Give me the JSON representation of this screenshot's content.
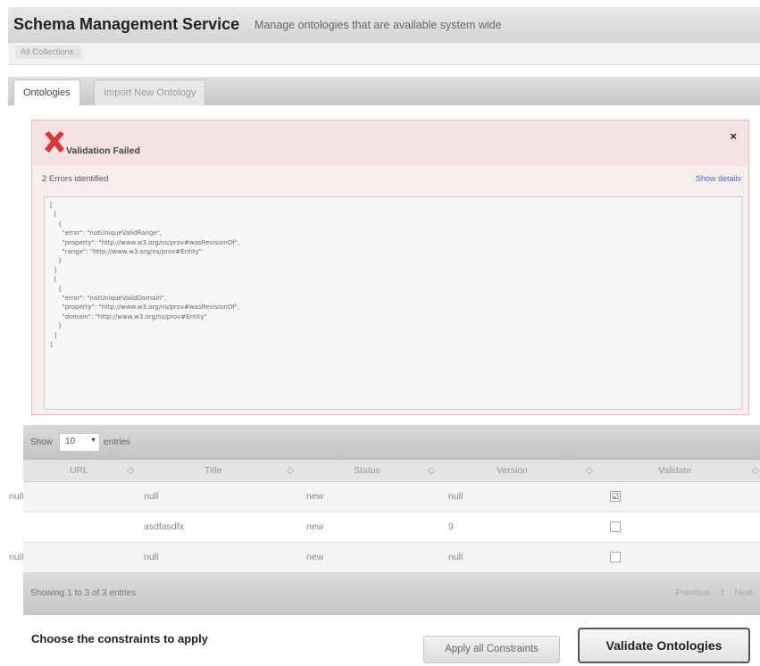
{
  "header": {
    "title": "Schema Management Service",
    "subtitle": "Manage ontologies that are available system wide"
  },
  "breadcrumb": {
    "item": "All Collections"
  },
  "tabs": [
    {
      "label": "Ontologies",
      "active": true
    },
    {
      "label": "Import New Ontology",
      "active": false
    }
  ],
  "alert": {
    "icon": "error-x-icon",
    "title": "Validation Failed",
    "close": "×",
    "error_count": "2 Errors identified",
    "show_details": "Show details",
    "details": "[\n  [\n    {\n      \"error\": \"notUniqueValidRange\",\n      \"property\": \"http://www.w3.org/ns/prov#wasRevisionOf\",\n      \"range\": \"http://www.w3.org/ns/prov#Entity\"\n    }\n  ]\n  [\n    {\n      \"error\": \"notUniqueValidDomain\",\n      \"property\": \"http://www.w3.org/ns/prov#wasRevisionOf\",\n      \"domain\": \"http://www.w3.org/ns/prov#Entity\"\n    }\n  ]\n]"
  },
  "table": {
    "show_label": "Show",
    "page_size": "10",
    "entries_label": "entries",
    "columns": [
      "URL",
      "Title",
      "Status",
      "Version",
      "Validate"
    ],
    "sort_glyph": "◇",
    "rows": [
      {
        "url": "null",
        "title": "null",
        "status": "new",
        "version": "null",
        "validate": "☑"
      },
      {
        "url": "",
        "title": "asdfasdfx",
        "status": "new",
        "version": "9",
        "validate": ""
      },
      {
        "url": "null",
        "title": "null",
        "status": "new",
        "version": "null",
        "validate": ""
      }
    ],
    "info": "Showing 1 to 3 of 3 entries",
    "pager": {
      "previous": "Previous",
      "page": "1",
      "next": "Next"
    }
  },
  "footer": {
    "constraints_label": "Choose the constraints to apply",
    "apply_button": "Apply all Constraints",
    "validate_button": "Validate Ontologies"
  },
  "colors": {
    "alert_bg": "#f9eeee",
    "alert_border": "#e8bcbc",
    "error_icon": "#d9383a",
    "link": "#4a62c8"
  }
}
